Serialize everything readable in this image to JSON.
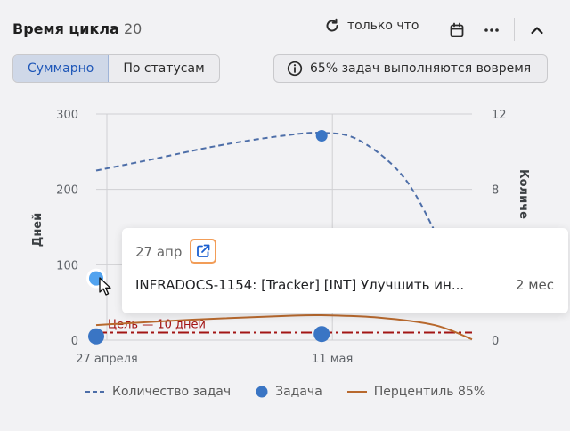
{
  "header": {
    "title": "Время цикла",
    "count": "20",
    "refresh_label": "только что"
  },
  "tabs": [
    {
      "label": "Суммарно",
      "active": true
    },
    {
      "label": "По статусам",
      "active": false
    }
  ],
  "ontime_badge": "65% задач выполняются вовремя",
  "chart_data": {
    "type": "line",
    "x_ticks": [
      "27 апреля",
      "11 мая"
    ],
    "y_left": {
      "label": "Дней",
      "ticks": [
        "0",
        "100",
        "200",
        "300"
      ],
      "lim": [
        0,
        300
      ]
    },
    "y_right": {
      "label": "Количе",
      "ticks": [
        "0",
        "4",
        "8",
        "12"
      ],
      "lim": [
        0,
        12
      ]
    },
    "goal_label": "Цель — 10 дней",
    "goal_value": 10,
    "legend": [
      "Количество задач",
      "Задача",
      "Перцентиль 85%"
    ],
    "series": [
      {
        "name": "Количество задач",
        "axis": "right",
        "points": [
          [
            0,
            9.0
          ],
          [
            0.15,
            9.6
          ],
          [
            0.32,
            10.3
          ],
          [
            0.48,
            10.8
          ],
          [
            0.6,
            11.0
          ],
          [
            0.7,
            10.6
          ],
          [
            0.82,
            8.6
          ],
          [
            0.92,
            5.0
          ],
          [
            1.0,
            1.5
          ]
        ]
      },
      {
        "name": "Задача",
        "points": [
          [
            0,
            5
          ],
          [
            0,
            82
          ],
          [
            0.6,
            271
          ],
          [
            0.6,
            8
          ]
        ]
      },
      {
        "name": "Перцентиль 85%",
        "points": [
          [
            0,
            20
          ],
          [
            0.25,
            27
          ],
          [
            0.5,
            32
          ],
          [
            0.6,
            33
          ],
          [
            0.75,
            30
          ],
          [
            0.9,
            20
          ],
          [
            1.0,
            1
          ]
        ]
      }
    ]
  },
  "tooltip": {
    "date": "27 апр",
    "issue_text": "INFRADOCS-1154: [Tracker] [INT] Улучшить ин...",
    "duration": "2 мес"
  },
  "colors": {
    "count_line": "#4d6ea8",
    "task_point": "#3a75c4",
    "task_point_hover": "#52a3ef",
    "percentile_line": "#b8692e",
    "goal_line": "#a31515",
    "accent": "#1f57b8",
    "link_highlight": "#f29d58"
  }
}
